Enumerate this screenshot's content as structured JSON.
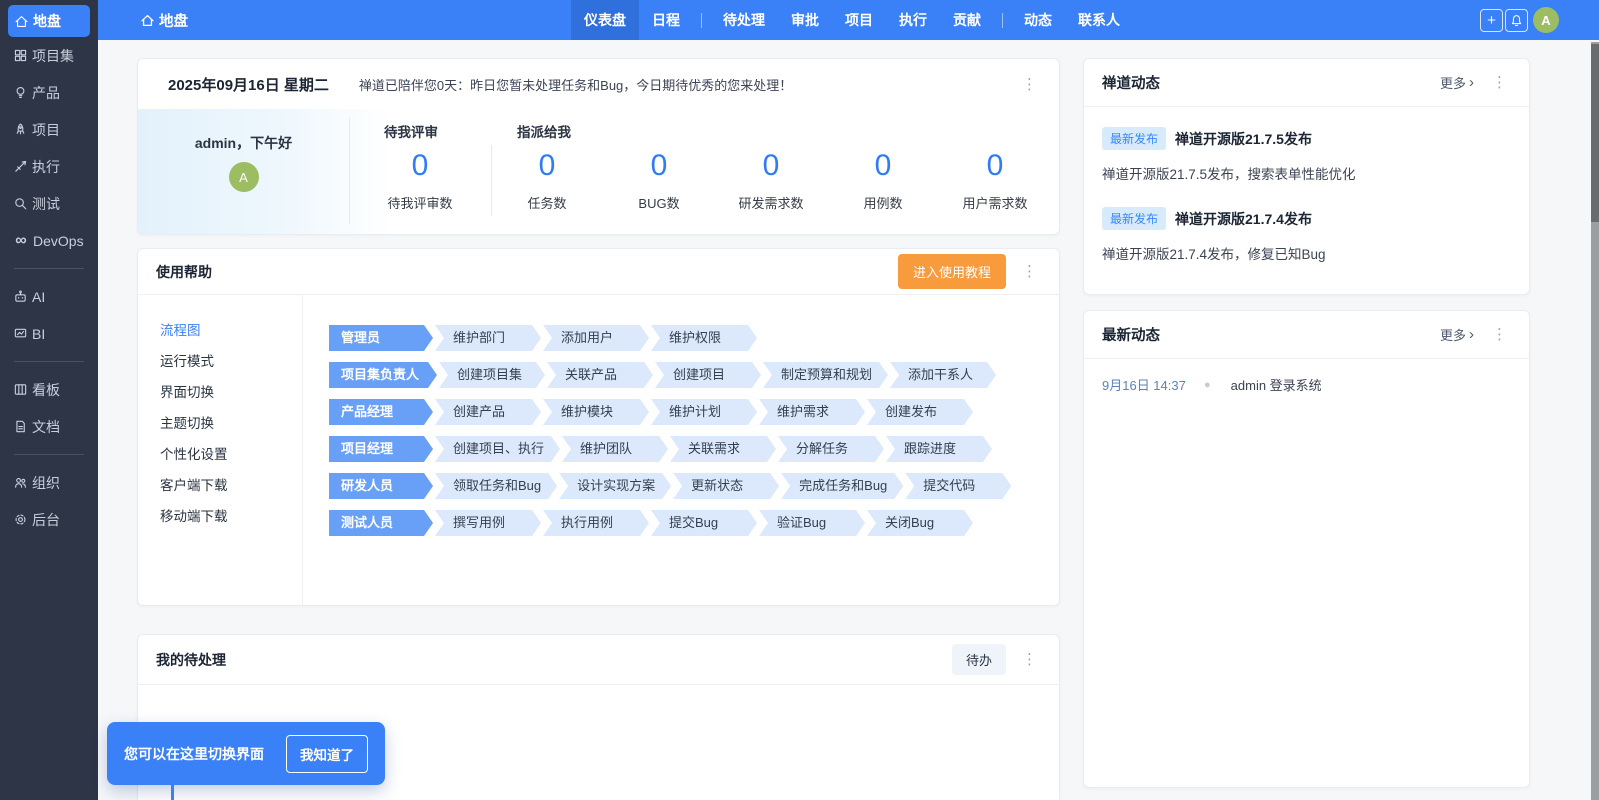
{
  "icons": {
    "kebab": "⋮",
    "plus": "+",
    "more_chevron": "›",
    "infinity": "∞",
    "dot": "●"
  },
  "colors": {
    "accent": "#3a80f7",
    "active_tab": "#2f70dd",
    "sidebar_bg": "#2d3547",
    "orange": "#f79b3c",
    "avatar_green": "#9dbd63",
    "stat_number": "#2f7cf6"
  },
  "sidebar": {
    "items": [
      {
        "label": "地盘",
        "icon": "home-icon",
        "active": true
      },
      {
        "label": "项目集",
        "icon": "grid-icon"
      },
      {
        "label": "产品",
        "icon": "bulb-icon"
      },
      {
        "label": "项目",
        "icon": "rocket-icon"
      },
      {
        "label": "执行",
        "icon": "dart-icon"
      },
      {
        "label": "测试",
        "icon": "search-icon"
      },
      {
        "label": "DevOps",
        "icon": "infinity-icon"
      },
      {
        "label": "AI",
        "icon": "robot-icon"
      },
      {
        "label": "BI",
        "icon": "bi-chart-icon"
      },
      {
        "label": "看板",
        "icon": "kanban-icon"
      },
      {
        "label": "文档",
        "icon": "doc-icon"
      },
      {
        "label": "组织",
        "icon": "org-icon"
      },
      {
        "label": "后台",
        "icon": "gear-icon"
      }
    ]
  },
  "topbar": {
    "home": "地盘",
    "tabs": [
      "仪表盘",
      "日程",
      "待处理",
      "审批",
      "项目",
      "执行",
      "贡献",
      "动态",
      "联系人"
    ],
    "active_tab": "仪表盘",
    "avatar": "A"
  },
  "welcome": {
    "date": "2025年09月16日 星期二",
    "message": "禅道已陪伴您0天：昨日您暂未处理任务和Bug，今日期待优秀的您来处理！",
    "greeting": "admin，下午好",
    "avatar": "A",
    "review_group_label": "待我评审",
    "assigned_group_label": "指派给我",
    "stats": [
      {
        "value": "0",
        "label": "待我评审数"
      },
      {
        "value": "0",
        "label": "任务数"
      },
      {
        "value": "0",
        "label": "BUG数"
      },
      {
        "value": "0",
        "label": "研发需求数"
      },
      {
        "value": "0",
        "label": "用例数"
      },
      {
        "value": "0",
        "label": "用户需求数"
      }
    ]
  },
  "help": {
    "title": "使用帮助",
    "tutorial_button": "进入使用教程",
    "active_menu": "流程图",
    "menu": [
      "流程图",
      "运行模式",
      "界面切换",
      "主题切换",
      "个性化设置",
      "客户端下载",
      "移动端下载"
    ],
    "flows": [
      {
        "role": "管理员",
        "steps": [
          "维护部门",
          "添加用户",
          "维护权限"
        ]
      },
      {
        "role": "项目集负责人",
        "steps": [
          "创建项目集",
          "关联产品",
          "创建项目",
          "制定预算和规划",
          "添加干系人"
        ]
      },
      {
        "role": "产品经理",
        "steps": [
          "创建产品",
          "维护模块",
          "维护计划",
          "维护需求",
          "创建发布"
        ]
      },
      {
        "role": "项目经理",
        "steps": [
          "创建项目、执行",
          "维护团队",
          "关联需求",
          "分解任务",
          "跟踪进度"
        ]
      },
      {
        "role": "研发人员",
        "steps": [
          "领取任务和Bug",
          "设计实现方案",
          "更新状态",
          "完成任务和Bug",
          "提交代码"
        ]
      },
      {
        "role": "测试人员",
        "steps": [
          "撰写用例",
          "执行用例",
          "提交Bug",
          "验证Bug",
          "关闭Bug"
        ]
      }
    ]
  },
  "todo": {
    "title": "我的待处理",
    "filter_label": "待办"
  },
  "zentao_news": {
    "title": "禅道动态",
    "more_label": "更多",
    "items": [
      {
        "badge": "最新发布",
        "title": "禅道开源版21.7.5发布",
        "desc": "禅道开源版21.7.5发布，搜索表单性能优化"
      },
      {
        "badge": "最新发布",
        "title": "禅道开源版21.7.4发布",
        "desc": "禅道开源版21.7.4发布，修复已知Bug"
      }
    ]
  },
  "latest_news": {
    "title": "最新动态",
    "more_label": "更多",
    "items": [
      {
        "time": "9月16日 14:37",
        "text": "admin 登录系统"
      }
    ]
  },
  "tooltip": {
    "text": "您可以在这里切换界面",
    "button": "我知道了"
  }
}
